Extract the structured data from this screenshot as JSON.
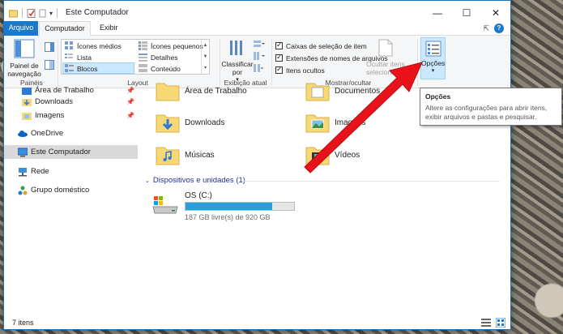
{
  "window": {
    "title": "Este Computador"
  },
  "tabs": {
    "file": "Arquivo",
    "computer": "Computador",
    "view": "Exibir"
  },
  "ribbon": {
    "panes": {
      "nav_pane_label": "Painel de navegação",
      "group": "Painéis"
    },
    "layout": {
      "items": [
        "Ícones médios",
        "Ícones pequenos",
        "Lista",
        "Detalhes",
        "Blocos",
        "Conteúdo"
      ],
      "selected": "Blocos",
      "group": "Layout"
    },
    "current_view": {
      "sort_label": "Classificar por",
      "group": "Exibição atual"
    },
    "show_hide": {
      "checkboxes": [
        "Caixas de seleção de item",
        "Extensões de nomes de arquivos",
        "Itens ocultos"
      ],
      "hide_selected": "Ocultar itens selecionados",
      "group": "Mostrar/ocultar"
    },
    "options_label": "Opções"
  },
  "navpane": {
    "items": [
      {
        "label": "Área de Trabalho",
        "icon": "desktop-folder-icon"
      },
      {
        "label": "Downloads",
        "icon": "download-folder-icon"
      },
      {
        "label": "Imagens",
        "icon": "pictures-folder-icon"
      },
      {
        "label": "OneDrive",
        "icon": "onedrive-icon"
      },
      {
        "label": "Este Computador",
        "icon": "computer-icon"
      },
      {
        "label": "Rede",
        "icon": "network-icon"
      },
      {
        "label": "Grupo doméstico",
        "icon": "homegroup-icon"
      }
    ],
    "selected": "Este Computador"
  },
  "content": {
    "folders": [
      {
        "label": "Área de Trabalho"
      },
      {
        "label": "Documentos"
      },
      {
        "label": "Downloads"
      },
      {
        "label": "Imagens"
      },
      {
        "label": "Músicas"
      },
      {
        "label": "Vídeos"
      }
    ],
    "devices_header": "Dispositivos e unidades (1)",
    "drive": {
      "name": "OS (C:)",
      "free_text": "187 GB livre(s) de 920 GB",
      "used_fraction": 0.797
    }
  },
  "status": {
    "item_count": "7 itens"
  },
  "tooltip": {
    "title": "Opções",
    "body": "Altere as configurações para abrir itens, exibir arquivos e pastas e pesquisar."
  },
  "colors": {
    "accent": "#1979ca",
    "drive_fill": "#26a0da",
    "folder": "#f8d775",
    "arrow": "#e8121b"
  }
}
